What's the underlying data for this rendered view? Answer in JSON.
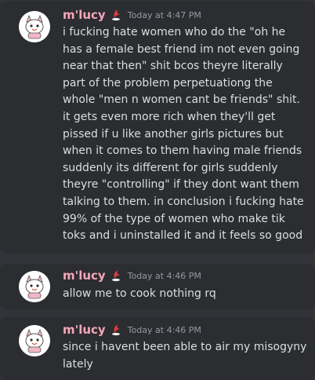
{
  "messages": [
    {
      "username": "m'lucy",
      "timestamp": "Today at 4:47 PM",
      "lines": [
        "i fucking hate women who do the \"oh he",
        "has a female best friend im not even going",
        "near that then\" shit bcos theyre literally",
        "part of the problem perpetuationg the",
        "whole \"men n women cant be friends\" shit.",
        "it gets even more rich when they'll get",
        "pissed if u like another girls pictures but",
        "when it comes to them having male friends",
        "suddenly its different for girls suddenly",
        "theyre \"controlling\" if they dont want them",
        "talking to them. in conclusion i fucking hate",
        "99% of the type of women who make tik",
        "toks and i uninstalled it and it feels so good"
      ]
    },
    {
      "username": "m'lucy",
      "timestamp": "Today at 4:46 PM",
      "lines": [
        "allow me to cook nothing rq"
      ]
    },
    {
      "username": "m'lucy",
      "timestamp": "Today at 4:46 PM",
      "lines": [
        "since i havent been able to air my misogyny",
        "lately"
      ]
    }
  ],
  "icons": {
    "avatar": "cartoon-character-avatar",
    "badge": "red-crescent-badge-icon"
  },
  "colors": {
    "background": "#313338",
    "message_background": "#2b2d31",
    "username": "#f4a6b8",
    "text": "#dbdee1",
    "timestamp": "#949ba4",
    "badge": "#e03a3a"
  }
}
